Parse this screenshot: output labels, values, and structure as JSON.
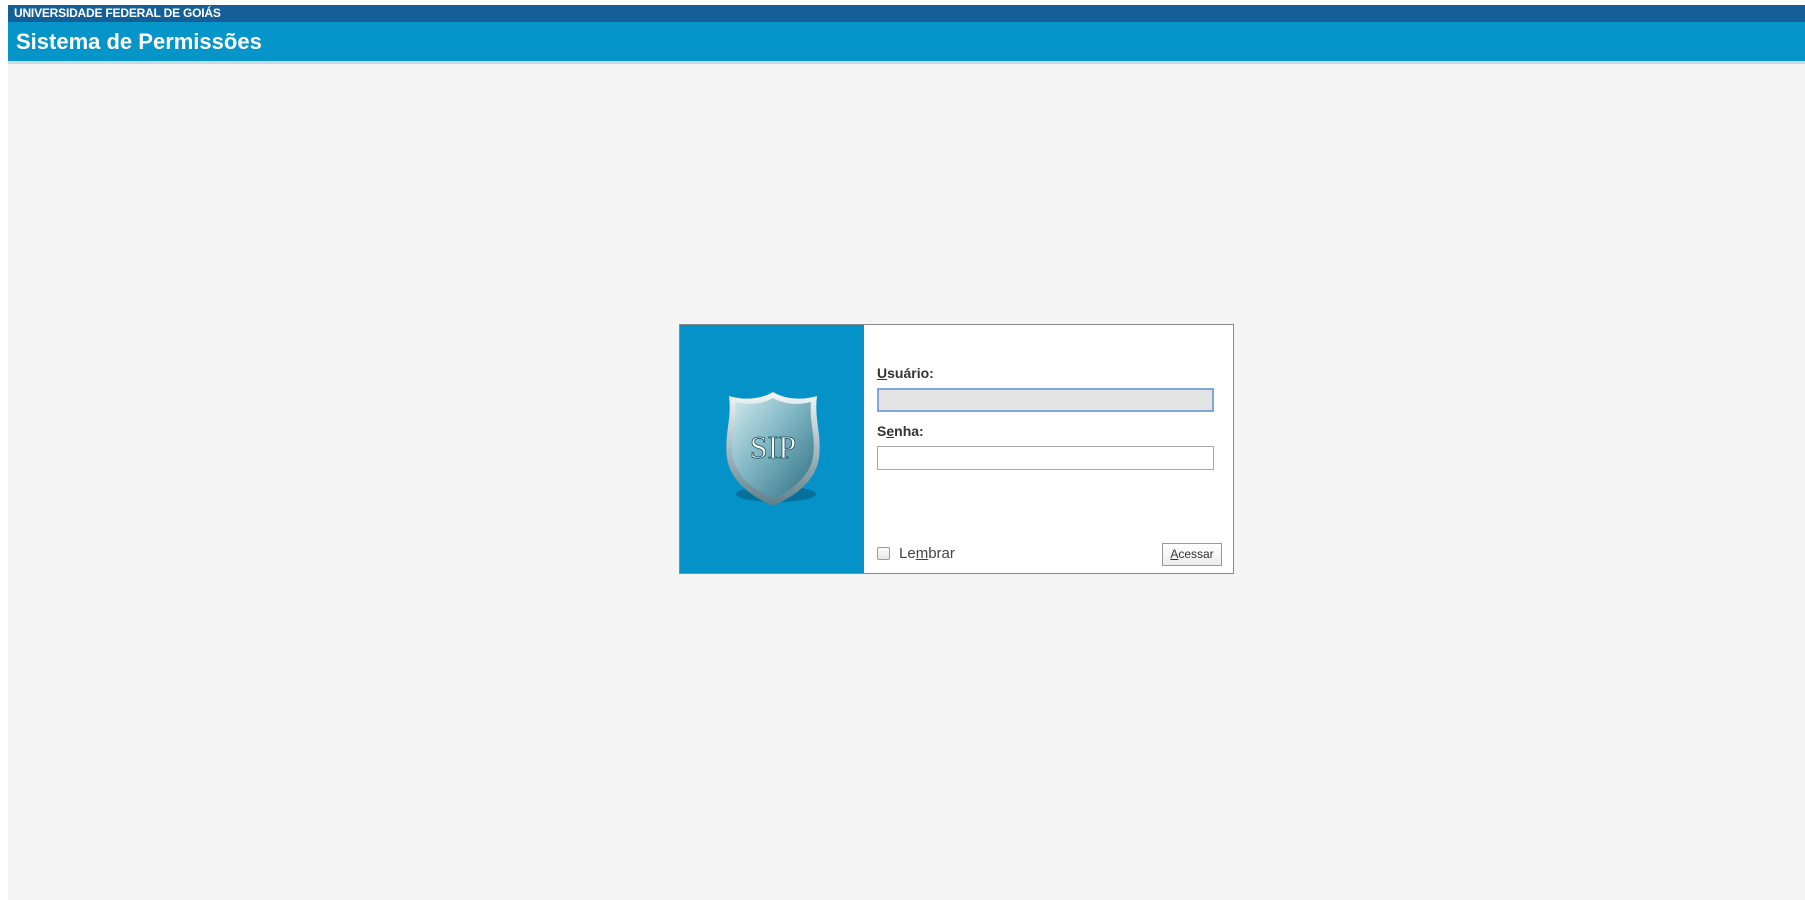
{
  "header": {
    "org_name": "UNIVERSIDADE FEDERAL DE GOIÁS",
    "system_title": "Sistema de Permissões"
  },
  "login": {
    "logo_text": "SIP",
    "user_label_accesskey": "U",
    "user_label_rest": "suário:",
    "user_value": "",
    "password_label_first": "S",
    "password_label_accesskey": "e",
    "password_label_rest": "nha:",
    "password_value": "",
    "remember_pre": "Le",
    "remember_accesskey": "m",
    "remember_post": "brar",
    "remember_checked": false,
    "access_accesskey": "A",
    "access_rest": "cessar"
  },
  "colors": {
    "org_bar": "#155f98",
    "title_bar": "#0595c9",
    "login_panel": "#0592c8",
    "page_background": "#f4f4f4"
  }
}
